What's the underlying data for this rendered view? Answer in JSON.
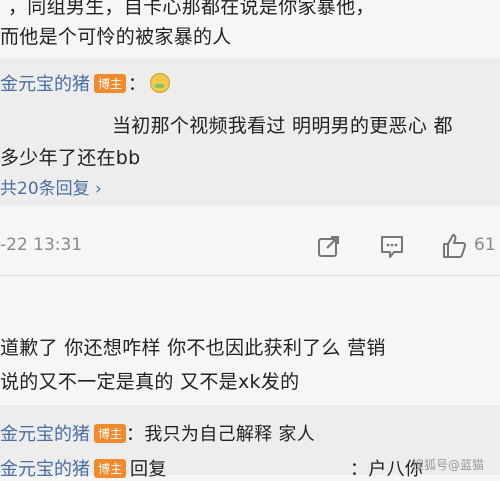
{
  "post": {
    "line1": "，同组男生，自卡心那都在说是你家暴他，",
    "line2": "而他是个可怜的被家暴的人"
  },
  "reply_thread_1": {
    "username": "金元宝的猪",
    "badge": "博主",
    "colon": "：",
    "emoji_name": "sick-face-emoji",
    "text_line1": "当初那个视频我看过 明明男的更恶心 都",
    "text_line2": "多少年了还在bb",
    "more_replies": "共20条回复 ›"
  },
  "comment_meta": {
    "date_time": "-22 13:31",
    "like_count": "61",
    "icons": [
      "share-icon",
      "comment-icon",
      "like-icon"
    ]
  },
  "comment2": {
    "line1": "道歉了 你还想咋样 你不也因此获利了么 营销",
    "line2": "说的又不一定是真的 又不是xk发的"
  },
  "reply_thread_2": {
    "username": "金元宝的猪",
    "badge": "博主",
    "reply1": "：我只为自己解释 家人",
    "reply2_prefix": "回复",
    "reply2_suffix": "：户八你"
  },
  "watermark": "搜狐号@蓝猫",
  "colors": {
    "username": "#4a6fa0",
    "badge": "#f08a2c",
    "background": "#f6f6f6",
    "reply_box": "#ededed"
  }
}
